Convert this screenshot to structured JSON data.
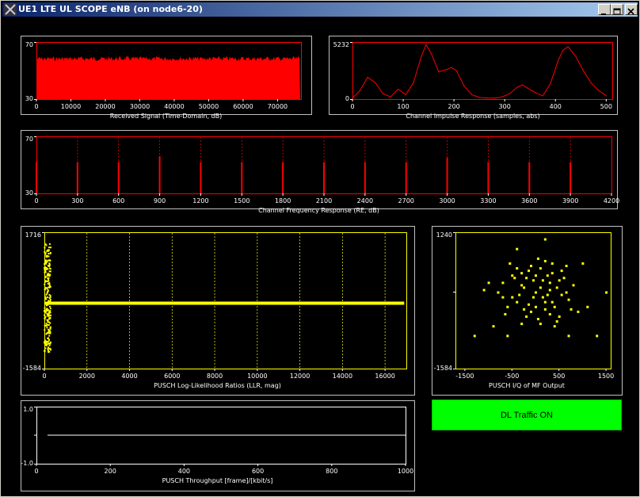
{
  "window": {
    "title": "UE1 LTE UL SCOPE eNB (on node6-20)",
    "icon": "x-logo-icon",
    "buttons": [
      "minimize-icon",
      "maximize-icon",
      "close-icon"
    ]
  },
  "status": {
    "dl_traffic_label": "DL Traffic ON",
    "dl_traffic_color": "#00ff00"
  },
  "colors": {
    "background": "#000000",
    "frame": "#c0c0c0",
    "trace_red": "#ff0000",
    "trace_yellow": "#ffff00",
    "trace_white": "#ffffff"
  },
  "chart_data": [
    {
      "id": "received-signal",
      "type": "area",
      "title": "Received Signal (Time-Domain, dB)",
      "xlim": [
        0,
        76800
      ],
      "ylim": [
        30,
        70
      ],
      "y_ticks": [
        "70",
        "30"
      ],
      "x_ticks": [
        "0",
        "10000",
        "20000",
        "30000",
        "40000",
        "50000",
        "60000",
        "70000"
      ],
      "series": [
        {
          "values_range": [
            30,
            60
          ],
          "fill": "noise-band"
        }
      ]
    },
    {
      "id": "channel-impulse-response",
      "type": "line",
      "title": "Channel Impulse Response (samples, abs)",
      "xlim": [
        0,
        512
      ],
      "ylim": [
        0,
        5232
      ],
      "y_ticks": [
        "5232",
        "0"
      ],
      "x_ticks": [
        "0",
        "100",
        "200",
        "300",
        "400",
        "500"
      ],
      "x": [
        0,
        15,
        30,
        45,
        60,
        75,
        90,
        105,
        120,
        135,
        145,
        155,
        170,
        185,
        195,
        205,
        220,
        235,
        250,
        265,
        280,
        295,
        310,
        325,
        335,
        345,
        360,
        375,
        390,
        405,
        415,
        425,
        440,
        455,
        470,
        485,
        500
      ],
      "y": [
        100,
        800,
        2000,
        1500,
        500,
        200,
        900,
        400,
        1500,
        3800,
        5000,
        4200,
        2500,
        2700,
        2900,
        2600,
        1200,
        400,
        150,
        100,
        80,
        200,
        500,
        1100,
        1300,
        1000,
        600,
        300,
        1400,
        3500,
        4500,
        4800,
        3900,
        2600,
        1500,
        800,
        300
      ]
    },
    {
      "id": "channel-frequency-response",
      "type": "bar",
      "title": "Channel Frequency  Response (RE, dB)",
      "xlim": [
        0,
        4200
      ],
      "ylim": [
        30,
        70
      ],
      "y_ticks": [
        "70",
        "30"
      ],
      "x_ticks": [
        "0",
        "300",
        "600",
        "900",
        "1200",
        "1500",
        "1800",
        "2100",
        "2400",
        "2700",
        "3000",
        "3300",
        "3600",
        "3900",
        "4200"
      ],
      "x": [
        0,
        300,
        600,
        900,
        1200,
        1500,
        1800,
        2100,
        2400,
        2700,
        3000,
        3300,
        3600,
        3900
      ],
      "values": [
        52,
        52,
        52,
        56,
        52,
        52,
        52,
        52,
        52,
        52,
        55,
        52,
        52,
        52
      ]
    },
    {
      "id": "pusch-llr",
      "type": "scatter",
      "title": "PUSCH Log-Likelihood Ratios (LLR, mag)",
      "xlim": [
        0,
        17000
      ],
      "ylim": [
        -1584,
        1716
      ],
      "y_ticks": [
        "1716",
        "-1584"
      ],
      "x_ticks": [
        "0",
        "2000",
        "4000",
        "6000",
        "8000",
        "10000",
        "12000",
        "14000",
        "16000"
      ],
      "flat_series": {
        "x_range": [
          0,
          16900
        ],
        "y": 0
      },
      "burst": {
        "x_range": [
          0,
          300
        ],
        "y_range": [
          -1200,
          1450
        ]
      }
    },
    {
      "id": "pusch-iq",
      "type": "scatter",
      "title": "PUSCH I/Q of MF Output",
      "xlim": [
        -1700,
        1600
      ],
      "ylim": [
        -1584,
        1240
      ],
      "y_ticks": [
        "1240",
        "-1584"
      ],
      "x_ticks": [
        "-1500",
        "-500",
        "500",
        "1500"
      ],
      "points": [
        [
          -300,
          400
        ],
        [
          -200,
          300
        ],
        [
          100,
          500
        ],
        [
          300,
          200
        ],
        [
          -500,
          -100
        ],
        [
          400,
          -300
        ],
        [
          0,
          0
        ],
        [
          200,
          -200
        ],
        [
          -100,
          -400
        ],
        [
          600,
          300
        ],
        [
          -700,
          200
        ],
        [
          350,
          600
        ],
        [
          150,
          -100
        ],
        [
          -250,
          100
        ],
        [
          500,
          -500
        ],
        [
          -400,
          500
        ],
        [
          250,
          350
        ],
        [
          50,
          700
        ],
        [
          -150,
          -250
        ],
        [
          700,
          -150
        ],
        [
          -600,
          -300
        ],
        [
          450,
          100
        ],
        [
          -50,
          250
        ],
        [
          300,
          -450
        ],
        [
          -350,
          -50
        ],
        [
          100,
          100
        ],
        [
          550,
          450
        ],
        [
          -200,
          -500
        ],
        [
          200,
          650
        ],
        [
          -450,
          300
        ],
        [
          650,
          0
        ],
        [
          0,
          -300
        ],
        [
          -800,
          0
        ],
        [
          400,
          -700
        ],
        [
          150,
          250
        ],
        [
          -100,
          550
        ],
        [
          800,
          150
        ],
        [
          -300,
          -650
        ],
        [
          250,
          -50
        ],
        [
          -550,
          600
        ],
        [
          350,
          -200
        ],
        [
          50,
          -550
        ],
        [
          -650,
          -450
        ],
        [
          500,
          250
        ],
        [
          -150,
          450
        ],
        [
          750,
          -350
        ],
        [
          -400,
          -200
        ],
        [
          0,
          350
        ],
        [
          300,
          50
        ],
        [
          -250,
          -350
        ],
        [
          450,
          -600
        ],
        [
          -500,
          350
        ],
        [
          200,
          -350
        ],
        [
          -50,
          -100
        ],
        [
          650,
          550
        ],
        [
          -700,
          -100
        ],
        [
          100,
          -650
        ],
        [
          350,
          400
        ],
        [
          -300,
          150
        ],
        [
          550,
          -50
        ],
        [
          -900,
          -700
        ],
        [
          900,
          -400
        ],
        [
          -1000,
          200
        ],
        [
          1000,
          600
        ],
        [
          -1100,
          50
        ],
        [
          1100,
          -300
        ],
        [
          700,
          -900
        ],
        [
          -600,
          -900
        ],
        [
          200,
          1100
        ],
        [
          -400,
          900
        ],
        [
          1300,
          -900
        ],
        [
          -1300,
          -900
        ],
        [
          1500,
          0
        ]
      ]
    },
    {
      "id": "pusch-throughput",
      "type": "line",
      "title": "PUSCH Throughput [frame]/[kbit/s]",
      "xlim": [
        0,
        1000
      ],
      "ylim": [
        -1.0,
        1.0
      ],
      "y_ticks": [
        "1.0",
        "-1.0"
      ],
      "x_ticks": [
        "0",
        "200",
        "400",
        "600",
        "800",
        "1000"
      ],
      "x": [
        30,
        1000
      ],
      "y": [
        0,
        0
      ]
    }
  ]
}
